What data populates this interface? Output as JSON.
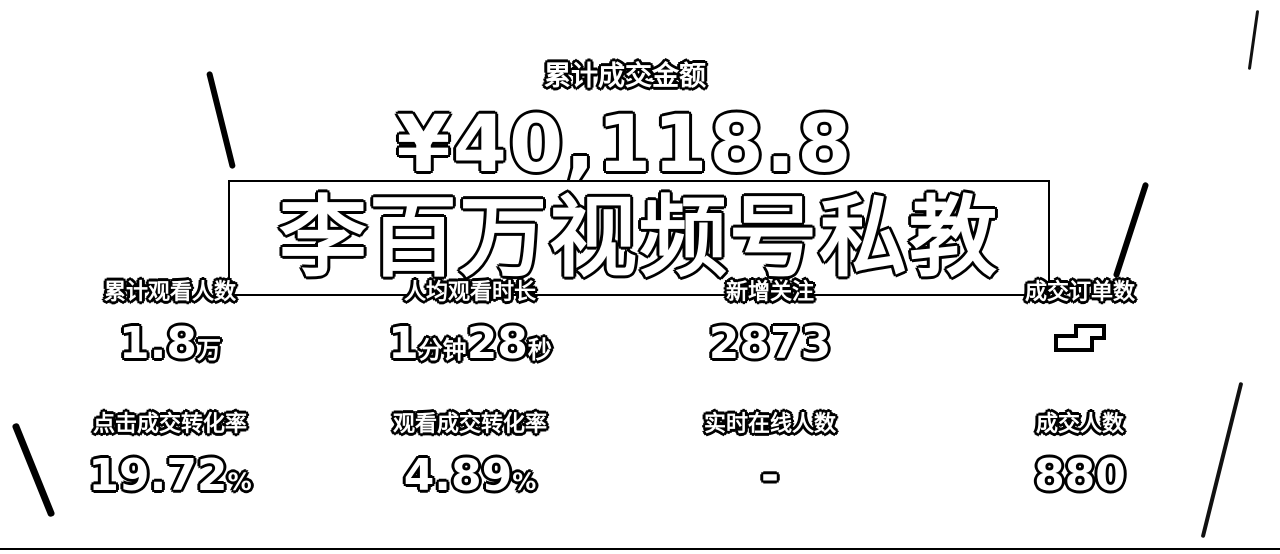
{
  "summary": {
    "total_label": "累计成交金额",
    "total_amount": "¥40,118.8"
  },
  "watermark": {
    "text": "李百万视频号私教"
  },
  "metrics_row1": [
    {
      "label": "累计观看人数",
      "value": "1.8",
      "unit": "万"
    },
    {
      "label": "人均观看时长",
      "value": "1",
      "unit": "分钟",
      "value2": "28",
      "unit2": "秒"
    },
    {
      "label": "新增关注",
      "value": "2873"
    },
    {
      "label": "成交订单数",
      "value": ""
    }
  ],
  "metrics_row2": [
    {
      "label": "点击成交转化率",
      "value": "19.72",
      "unit": "%"
    },
    {
      "label": "观看成交转化率",
      "value": "4.89",
      "unit": "%"
    },
    {
      "label": "实时在线人数",
      "value": "-"
    },
    {
      "label": "成交人数",
      "value": "880"
    }
  ]
}
